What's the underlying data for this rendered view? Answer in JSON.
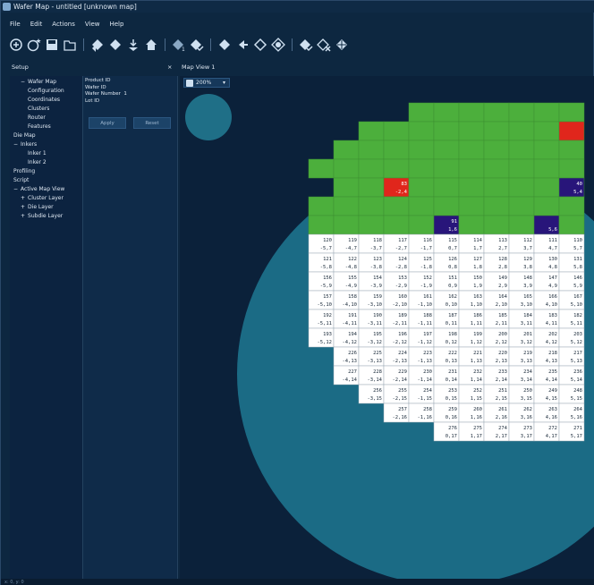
{
  "window": {
    "title": "Wafer Map - untitled [unknown map]"
  },
  "menu": [
    "File",
    "Edit",
    "Actions",
    "View",
    "Help"
  ],
  "toolbar_icons": [
    "add-wafer-icon",
    "add-wafer-star-icon",
    "save-icon",
    "open-icon",
    "bin-left-icon",
    "bin-right-icon",
    "download-icon",
    "home-icon",
    "bin-1-icon",
    "bin-check-icon",
    "arrow-left-icon",
    "arrow-left-alt-icon",
    "diamond-icon",
    "target-icon",
    "check-icon",
    "x-icon",
    "nav-icon"
  ],
  "panels": {
    "setup_title": "Setup",
    "close_glyph": "×",
    "mapview_title": "Map View 1"
  },
  "tree": [
    {
      "label": "Wafer Map",
      "indent": 1,
      "expander": "−"
    },
    {
      "label": "Configuration",
      "indent": 2
    },
    {
      "label": "Coordinates",
      "indent": 2
    },
    {
      "label": "Clusters",
      "indent": 2
    },
    {
      "label": "Router",
      "indent": 2
    },
    {
      "label": "Features",
      "indent": 2
    },
    {
      "label": "Die Map",
      "indent": 0
    },
    {
      "label": "Inkers",
      "indent": 0,
      "expander": "−"
    },
    {
      "label": "Inker 1",
      "indent": 2
    },
    {
      "label": "Inker 2",
      "indent": 2
    },
    {
      "label": "Profiling",
      "indent": 0
    },
    {
      "label": "Script",
      "indent": 0
    },
    {
      "label": "Active Map View",
      "indent": 0,
      "expander": "−"
    },
    {
      "label": "Cluster Layer",
      "indent": 1,
      "expander": "+"
    },
    {
      "label": "Die Layer",
      "indent": 1,
      "expander": "+"
    },
    {
      "label": "Subdie Layer",
      "indent": 1,
      "expander": "+"
    }
  ],
  "properties": [
    {
      "label": "Product ID"
    },
    {
      "label": "Wafer ID"
    },
    {
      "label": "Wafer Number",
      "value": "1"
    },
    {
      "label": "Lot ID"
    }
  ],
  "buttons": {
    "apply": "Apply",
    "reset": "Reset"
  },
  "zoom": {
    "value": "200%"
  },
  "colors": {
    "pass": "#4caf3c",
    "fail": "#e0261c",
    "blue": "#28157a",
    "white": "#ffffff",
    "wafer": "#1b6b85"
  },
  "die_rows": [
    {
      "cells": [
        {
          "bin": "",
          "coord": "",
          "c": "g"
        },
        {
          "bin": "",
          "coord": "",
          "c": "g"
        },
        {
          "bin": "",
          "coord": "",
          "c": "g"
        },
        {
          "bin": "",
          "coord": "",
          "c": "g"
        },
        {
          "bin": "",
          "coord": "",
          "c": "g"
        },
        {
          "bin": "",
          "coord": "",
          "c": "g"
        },
        {
          "bin": "",
          "coord": "",
          "c": "g"
        }
      ],
      "start": 4
    },
    {
      "cells": [
        {
          "bin": "",
          "coord": "",
          "c": "g"
        },
        {
          "bin": "",
          "coord": "",
          "c": "g"
        },
        {
          "bin": "",
          "coord": "",
          "c": "g"
        },
        {
          "bin": "",
          "coord": "",
          "c": "g"
        },
        {
          "bin": "",
          "coord": "",
          "c": "g"
        },
        {
          "bin": "",
          "coord": "",
          "c": "g"
        },
        {
          "bin": "",
          "coord": "",
          "c": "g"
        },
        {
          "bin": "",
          "coord": "",
          "c": "g"
        },
        {
          "bin": "",
          "coord": "",
          "c": "r"
        }
      ],
      "start": 2
    },
    {
      "cells": [
        {
          "bin": "",
          "coord": "",
          "c": "g"
        },
        {
          "bin": "",
          "coord": "",
          "c": "g"
        },
        {
          "bin": "",
          "coord": "",
          "c": "g"
        },
        {
          "bin": "",
          "coord": "",
          "c": "g"
        },
        {
          "bin": "",
          "coord": "",
          "c": "g"
        },
        {
          "bin": "",
          "coord": "",
          "c": "g"
        },
        {
          "bin": "",
          "coord": "",
          "c": "g"
        },
        {
          "bin": "",
          "coord": "",
          "c": "g"
        },
        {
          "bin": "",
          "coord": "",
          "c": "g"
        },
        {
          "bin": "",
          "coord": "",
          "c": "g"
        }
      ],
      "start": 1
    },
    {
      "cells": [
        {
          "bin": "",
          "coord": "",
          "c": "g"
        },
        {
          "bin": "",
          "coord": "",
          "c": "g"
        },
        {
          "bin": "",
          "coord": "",
          "c": "g"
        },
        {
          "bin": "",
          "coord": "",
          "c": "g"
        },
        {
          "bin": "",
          "coord": "",
          "c": "g"
        },
        {
          "bin": "",
          "coord": "",
          "c": "g"
        },
        {
          "bin": "",
          "coord": "",
          "c": "g"
        },
        {
          "bin": "",
          "coord": "",
          "c": "g"
        },
        {
          "bin": "",
          "coord": "",
          "c": "g"
        },
        {
          "bin": "",
          "coord": "",
          "c": "g"
        },
        {
          "bin": "",
          "coord": "",
          "c": "g"
        }
      ],
      "start": 0
    },
    {
      "cells": [
        {
          "bin": "",
          "coord": "",
          "c": "g"
        },
        {
          "bin": "",
          "coord": "",
          "c": "g"
        },
        {
          "bin": "83",
          "coord": "-2,4",
          "c": "r"
        },
        {
          "bin": "",
          "coord": "",
          "c": "g"
        },
        {
          "bin": "",
          "coord": "",
          "c": "g"
        },
        {
          "bin": "",
          "coord": "",
          "c": "g"
        },
        {
          "bin": "",
          "coord": "",
          "c": "g"
        },
        {
          "bin": "",
          "coord": "",
          "c": "g"
        },
        {
          "bin": "",
          "coord": "",
          "c": "g"
        },
        {
          "bin": "40",
          "coord": "5,4",
          "c": "b"
        }
      ],
      "start": 1
    },
    {
      "cells": [
        {
          "bin": "",
          "coord": "",
          "c": "g"
        },
        {
          "bin": "",
          "coord": "",
          "c": "g"
        },
        {
          "bin": "",
          "coord": "",
          "c": "g"
        },
        {
          "bin": "",
          "coord": "",
          "c": "g"
        },
        {
          "bin": "",
          "coord": "",
          "c": "g"
        },
        {
          "bin": "",
          "coord": "",
          "c": "g"
        },
        {
          "bin": "",
          "coord": "",
          "c": "g"
        },
        {
          "bin": "",
          "coord": "",
          "c": "g"
        },
        {
          "bin": "",
          "coord": "",
          "c": "g"
        },
        {
          "bin": "",
          "coord": "",
          "c": "g"
        },
        {
          "bin": "",
          "coord": "",
          "c": "g"
        }
      ],
      "start": 0
    },
    {
      "cells": [
        {
          "bin": "",
          "coord": "",
          "c": "g"
        },
        {
          "bin": "",
          "coord": "",
          "c": "g"
        },
        {
          "bin": "",
          "coord": "",
          "c": "g"
        },
        {
          "bin": "",
          "coord": "",
          "c": "g"
        },
        {
          "bin": "",
          "coord": "",
          "c": "g"
        },
        {
          "bin": "91",
          "coord": "1,6",
          "c": "b"
        },
        {
          "bin": "",
          "coord": "",
          "c": "g"
        },
        {
          "bin": "",
          "coord": "",
          "c": "g"
        },
        {
          "bin": "",
          "coord": "",
          "c": "g"
        },
        {
          "bin": "",
          "coord": "5,6",
          "c": "b"
        },
        {
          "bin": "",
          "coord": "",
          "c": "g"
        }
      ],
      "start": 0
    },
    {
      "cells": [
        {
          "bin": "120",
          "coord": "-5,7"
        },
        {
          "bin": "119",
          "coord": "-4,7"
        },
        {
          "bin": "118",
          "coord": "-3,7"
        },
        {
          "bin": "117",
          "coord": "-2,7"
        },
        {
          "bin": "116",
          "coord": "-1,7"
        },
        {
          "bin": "115",
          "coord": "0,7"
        },
        {
          "bin": "114",
          "coord": "1,7"
        },
        {
          "bin": "113",
          "coord": "2,7"
        },
        {
          "bin": "112",
          "coord": "3,7"
        },
        {
          "bin": "111",
          "coord": "4,7"
        },
        {
          "bin": "110",
          "coord": "5,7"
        }
      ],
      "start": 0
    },
    {
      "cells": [
        {
          "bin": "121",
          "coord": "-5,8"
        },
        {
          "bin": "122",
          "coord": "-4,8"
        },
        {
          "bin": "123",
          "coord": "-3,8"
        },
        {
          "bin": "124",
          "coord": "-2,8"
        },
        {
          "bin": "125",
          "coord": "-1,8"
        },
        {
          "bin": "126",
          "coord": "0,8"
        },
        {
          "bin": "127",
          "coord": "1,8"
        },
        {
          "bin": "128",
          "coord": "2,8"
        },
        {
          "bin": "129",
          "coord": "3,8"
        },
        {
          "bin": "130",
          "coord": "4,8"
        },
        {
          "bin": "131",
          "coord": "5,8"
        }
      ],
      "start": 0
    },
    {
      "cells": [
        {
          "bin": "156",
          "coord": "-5,9"
        },
        {
          "bin": "155",
          "coord": "-4,9"
        },
        {
          "bin": "154",
          "coord": "-3,9"
        },
        {
          "bin": "153",
          "coord": "-2,9"
        },
        {
          "bin": "152",
          "coord": "-1,9"
        },
        {
          "bin": "151",
          "coord": "0,9"
        },
        {
          "bin": "150",
          "coord": "1,9"
        },
        {
          "bin": "149",
          "coord": "2,9"
        },
        {
          "bin": "148",
          "coord": "3,9"
        },
        {
          "bin": "147",
          "coord": "4,9"
        },
        {
          "bin": "146",
          "coord": "5,9"
        }
      ],
      "start": 0
    },
    {
      "cells": [
        {
          "bin": "157",
          "coord": "-5,10"
        },
        {
          "bin": "158",
          "coord": "-4,10"
        },
        {
          "bin": "159",
          "coord": "-3,10"
        },
        {
          "bin": "160",
          "coord": "-2,10"
        },
        {
          "bin": "161",
          "coord": "-1,10"
        },
        {
          "bin": "162",
          "coord": "0,10"
        },
        {
          "bin": "163",
          "coord": "1,10"
        },
        {
          "bin": "164",
          "coord": "2,10"
        },
        {
          "bin": "165",
          "coord": "3,10"
        },
        {
          "bin": "166",
          "coord": "4,10"
        },
        {
          "bin": "167",
          "coord": "5,10"
        }
      ],
      "start": 0
    },
    {
      "cells": [
        {
          "bin": "192",
          "coord": "-5,11"
        },
        {
          "bin": "191",
          "coord": "-4,11"
        },
        {
          "bin": "190",
          "coord": "-3,11"
        },
        {
          "bin": "189",
          "coord": "-2,11"
        },
        {
          "bin": "188",
          "coord": "-1,11"
        },
        {
          "bin": "187",
          "coord": "0,11"
        },
        {
          "bin": "186",
          "coord": "1,11"
        },
        {
          "bin": "185",
          "coord": "2,11"
        },
        {
          "bin": "184",
          "coord": "3,11"
        },
        {
          "bin": "183",
          "coord": "4,11"
        },
        {
          "bin": "182",
          "coord": "5,11"
        }
      ],
      "start": 0
    },
    {
      "cells": [
        {
          "bin": "193",
          "coord": "-5,12"
        },
        {
          "bin": "194",
          "coord": "-4,12"
        },
        {
          "bin": "195",
          "coord": "-3,12"
        },
        {
          "bin": "196",
          "coord": "-2,12"
        },
        {
          "bin": "197",
          "coord": "-1,12"
        },
        {
          "bin": "198",
          "coord": "0,12"
        },
        {
          "bin": "199",
          "coord": "1,12"
        },
        {
          "bin": "200",
          "coord": "2,12"
        },
        {
          "bin": "201",
          "coord": "3,12"
        },
        {
          "bin": "202",
          "coord": "4,12"
        },
        {
          "bin": "203",
          "coord": "5,12"
        }
      ],
      "start": 0
    },
    {
      "cells": [
        {
          "bin": "226",
          "coord": "-4,13"
        },
        {
          "bin": "225",
          "coord": "-3,13"
        },
        {
          "bin": "224",
          "coord": "-2,13"
        },
        {
          "bin": "223",
          "coord": "-1,13"
        },
        {
          "bin": "222",
          "coord": "0,13"
        },
        {
          "bin": "221",
          "coord": "1,13"
        },
        {
          "bin": "220",
          "coord": "2,13"
        },
        {
          "bin": "219",
          "coord": "3,13"
        },
        {
          "bin": "218",
          "coord": "4,13"
        },
        {
          "bin": "217",
          "coord": "5,13"
        }
      ],
      "start": 1
    },
    {
      "cells": [
        {
          "bin": "227",
          "coord": "-4,14"
        },
        {
          "bin": "228",
          "coord": "-3,14"
        },
        {
          "bin": "229",
          "coord": "-2,14"
        },
        {
          "bin": "230",
          "coord": "-1,14"
        },
        {
          "bin": "231",
          "coord": "0,14"
        },
        {
          "bin": "232",
          "coord": "1,14"
        },
        {
          "bin": "233",
          "coord": "2,14"
        },
        {
          "bin": "234",
          "coord": "3,14"
        },
        {
          "bin": "235",
          "coord": "4,14"
        },
        {
          "bin": "236",
          "coord": "5,14"
        }
      ],
      "start": 1
    },
    {
      "cells": [
        {
          "bin": "256",
          "coord": "-3,15"
        },
        {
          "bin": "255",
          "coord": "-2,15"
        },
        {
          "bin": "254",
          "coord": "-1,15"
        },
        {
          "bin": "253",
          "coord": "0,15"
        },
        {
          "bin": "252",
          "coord": "1,15"
        },
        {
          "bin": "251",
          "coord": "2,15"
        },
        {
          "bin": "250",
          "coord": "3,15"
        },
        {
          "bin": "249",
          "coord": "4,15"
        },
        {
          "bin": "248",
          "coord": "5,15"
        }
      ],
      "start": 2
    },
    {
      "cells": [
        {
          "bin": "257",
          "coord": "-2,16"
        },
        {
          "bin": "258",
          "coord": "-1,16"
        },
        {
          "bin": "259",
          "coord": "0,16"
        },
        {
          "bin": "260",
          "coord": "1,16"
        },
        {
          "bin": "261",
          "coord": "2,16"
        },
        {
          "bin": "262",
          "coord": "3,16"
        },
        {
          "bin": "263",
          "coord": "4,16"
        },
        {
          "bin": "264",
          "coord": "5,16"
        }
      ],
      "start": 3
    },
    {
      "cells": [
        {
          "bin": "276",
          "coord": "0,17"
        },
        {
          "bin": "275",
          "coord": "1,17"
        },
        {
          "bin": "274",
          "coord": "2,17"
        },
        {
          "bin": "273",
          "coord": "3,17"
        },
        {
          "bin": "272",
          "coord": "4,17"
        },
        {
          "bin": "271",
          "coord": "5,17"
        }
      ],
      "start": 5
    }
  ],
  "status": {
    "left": "x: 0, y: 0",
    "center": ""
  }
}
